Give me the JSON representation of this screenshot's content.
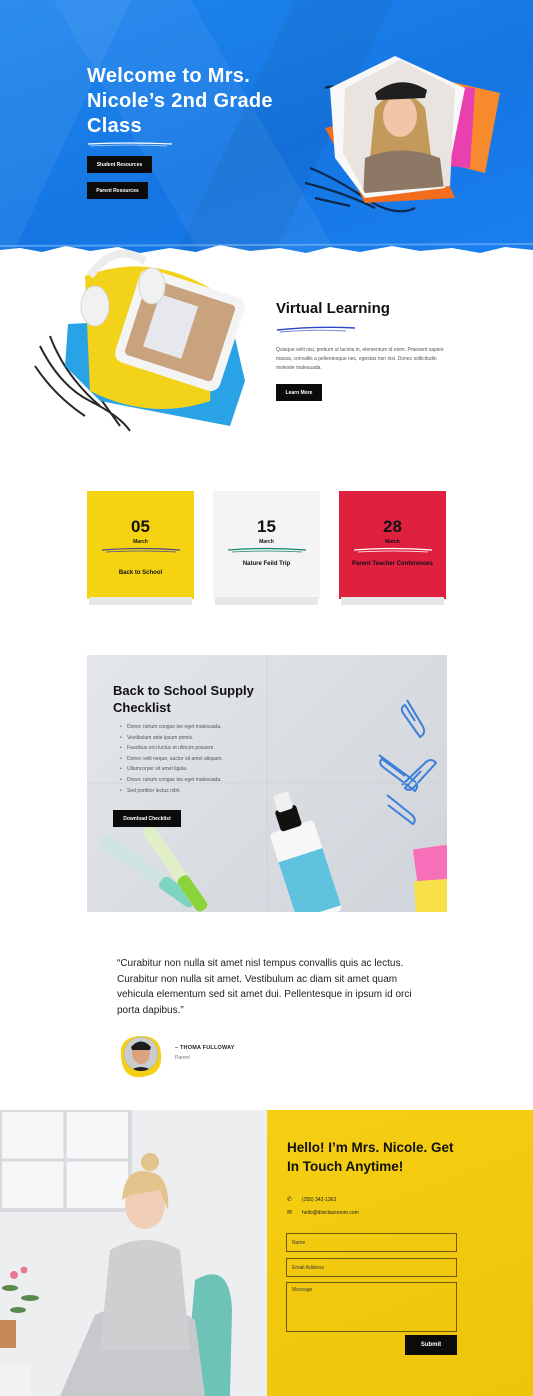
{
  "hero": {
    "title": "Welcome to Mrs. Nicole’s 2nd Grade Class",
    "buttons": [
      "Student Resources",
      "Parent Resources"
    ],
    "colors": {
      "background": "#1a7ff0",
      "button": "#0b0b0b"
    }
  },
  "virtual": {
    "title": "Virtual Learning",
    "body": "Quisque velit nisi, pretium ut lacinia in, elementum id enim. Praesent sapien massa, convallis a pellentesque nec, egestas non nisi. Donec sollicitudin molestie malesuada.",
    "button": "Learn More"
  },
  "events": [
    {
      "day": "05",
      "month": "March",
      "name": "Back to School",
      "color": "#f5d310"
    },
    {
      "day": "15",
      "month": "March",
      "name": "Nature Feild Trip",
      "color": "#f4f4f4"
    },
    {
      "day": "28",
      "month": "March",
      "name": "Parent Teacher Conferences",
      "color": "#e0203f"
    }
  ],
  "checklist": {
    "title": "Back to School Supply Checklist",
    "items": [
      "Donec rutrum congue leo eget malesuada.",
      "Vestibulum ante ipsum primis.",
      "Faucibus orci luctus et ultrices posuere.",
      "Donec velit neque, auctor sit amet aliquam.",
      "Ullamcorper sit amet ligula.",
      "Donec rutrum congue leo eget malesuada.",
      "Sed porttitor lectus nibh."
    ],
    "button": "Download Checklist"
  },
  "testimonial": {
    "quote": "“Curabitur non nulla sit amet nisl tempus convallis quis ac lectus. Curabitur non nulla sit amet. Vestibulum ac diam sit amet quam vehicula elementum sed sit amet dui. Pellentesque in ipsum id orci porta dapibus.”",
    "name": "– THOMA FULLOWAY",
    "role": "Parent"
  },
  "contact": {
    "title": "Hello! I’m Mrs. Nicole. Get In Touch Anytime!",
    "phone": "(255) 342-1363",
    "email": "hello@diviclassroom.com",
    "fields": {
      "name": "Name",
      "email": "Email Address",
      "message": "Message"
    },
    "submit": "Submit",
    "colors": {
      "panel": "#f3cb10"
    }
  }
}
